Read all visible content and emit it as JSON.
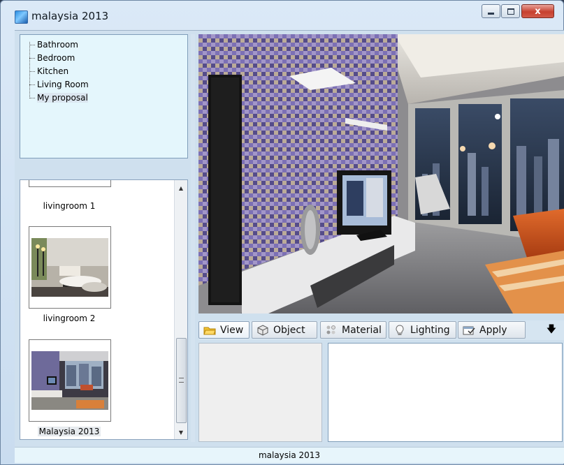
{
  "window": {
    "title": "malaysia 2013",
    "close_glyph": "x"
  },
  "tree": {
    "items": [
      {
        "label": "Bathroom"
      },
      {
        "label": "Bedroom"
      },
      {
        "label": "Kitchen"
      },
      {
        "label": "Living Room"
      },
      {
        "label": "My proposal",
        "selected": true
      }
    ]
  },
  "thumbnails": [
    {
      "label": "livingroom 1"
    },
    {
      "label": "livingroom 2"
    },
    {
      "label": "Malaysia 2013",
      "selected": true
    }
  ],
  "tabs": [
    {
      "label": "View",
      "icon": "folder-icon",
      "active": true
    },
    {
      "label": "Object",
      "icon": "cube-icon"
    },
    {
      "label": "Material",
      "icon": "palette-icon"
    },
    {
      "label": "Lighting",
      "icon": "bulb-icon"
    },
    {
      "label": "Apply",
      "icon": "apply-icon"
    }
  ],
  "toolbar": {
    "more_glyph": "🡇"
  },
  "status": {
    "text": "malaysia 2013"
  },
  "colors": {
    "title_bar": "#dbe9f7",
    "tree_bg": "#e4f6fc",
    "status_bg": "#e7f5fb",
    "close_button": "#c7402f"
  }
}
